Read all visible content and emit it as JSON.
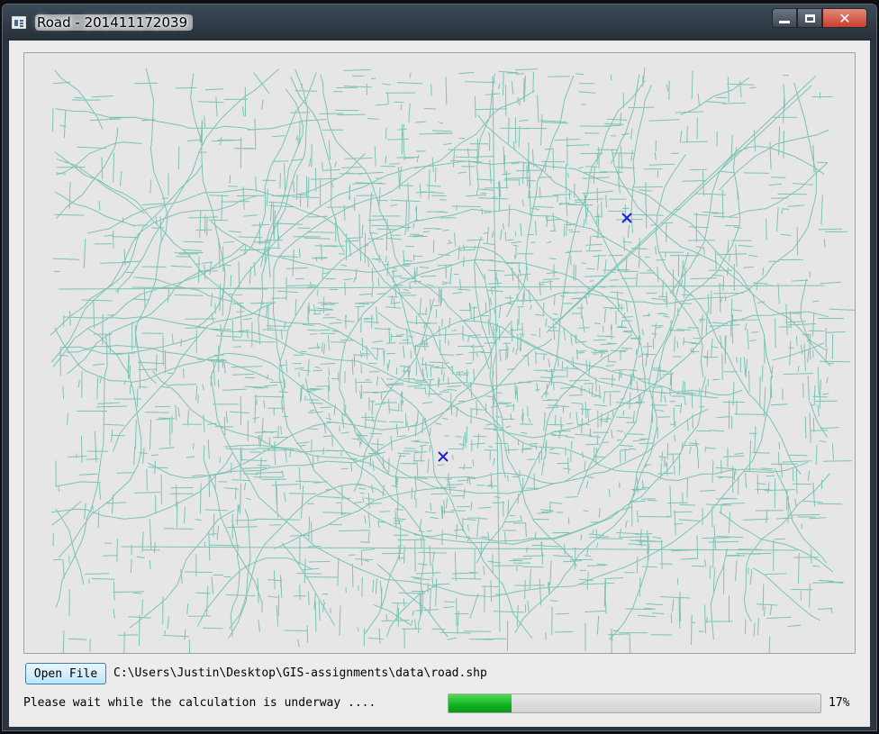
{
  "window": {
    "title": "Road - 201411172039",
    "minimize_glyph": "",
    "maximize_glyph": "",
    "close_glyph": "✕"
  },
  "map": {
    "road_color": "#7cc3b4",
    "marker_color": "#1e1ed8",
    "background": "#e6e6e6",
    "marker_count": 2
  },
  "toolbar": {
    "open_label": "Open File",
    "file_path": "C:\\Users\\Justin\\Desktop\\GIS-assignments\\data\\road.shp"
  },
  "status": {
    "message": "Please wait while the calculation is underway ....",
    "progress_value": 0.17,
    "progress_label": "17%",
    "progress_color": "#14b424"
  }
}
